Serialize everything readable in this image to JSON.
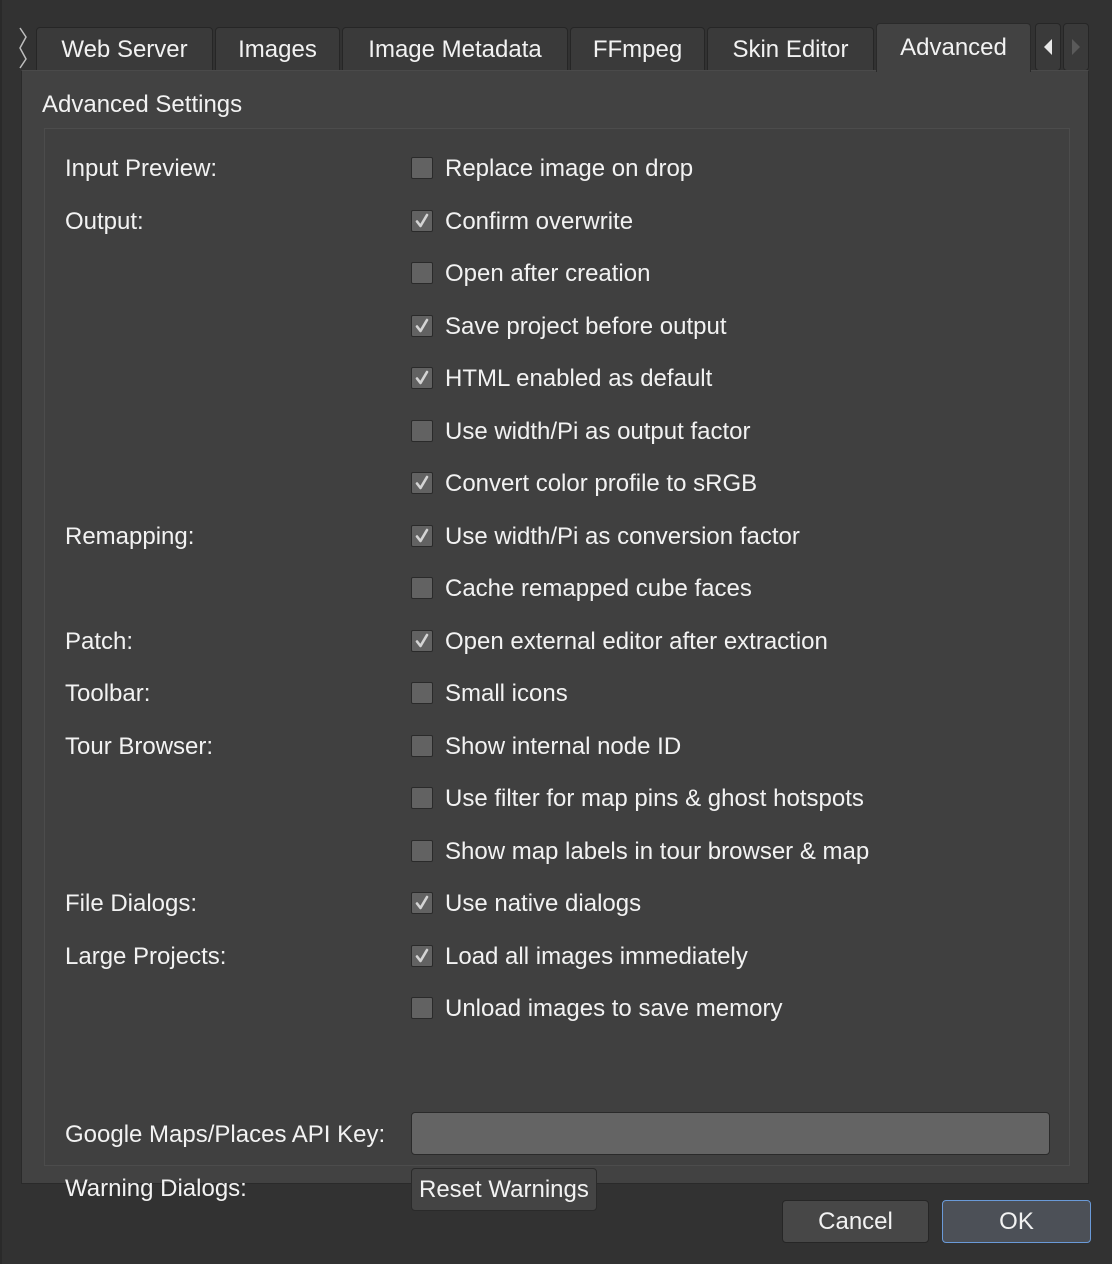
{
  "tabs": [
    {
      "label": "Web Server",
      "active": false
    },
    {
      "label": "Images",
      "active": false
    },
    {
      "label": "Image Metadata",
      "active": false
    },
    {
      "label": "FFmpeg",
      "active": false
    },
    {
      "label": "Skin Editor",
      "active": false
    },
    {
      "label": "Advanced",
      "active": true
    }
  ],
  "tab_scroll": {
    "left_icon": "triangle-left-icon",
    "right_icon": "triangle-right-icon",
    "right_enabled": false
  },
  "section_title": "Advanced Settings",
  "settings": [
    {
      "group": "Input Preview:",
      "label": "Replace image on drop",
      "checked": false
    },
    {
      "group": "Output:",
      "label": "Confirm overwrite",
      "checked": true
    },
    {
      "group": "",
      "label": "Open after creation",
      "checked": false
    },
    {
      "group": "",
      "label": "Save project before output",
      "checked": true
    },
    {
      "group": "",
      "label": "HTML enabled as default",
      "checked": true
    },
    {
      "group": "",
      "label": "Use width/Pi as output factor",
      "checked": false
    },
    {
      "group": "",
      "label": "Convert color profile to sRGB",
      "checked": true
    },
    {
      "group": "Remapping:",
      "label": "Use width/Pi as conversion factor",
      "checked": true
    },
    {
      "group": "",
      "label": "Cache remapped cube faces",
      "checked": false
    },
    {
      "group": "Patch:",
      "label": "Open external editor after extraction",
      "checked": true
    },
    {
      "group": "Toolbar:",
      "label": "Small icons",
      "checked": false
    },
    {
      "group": "Tour Browser:",
      "label": "Show internal node ID",
      "checked": false
    },
    {
      "group": "",
      "label": "Use filter for map pins & ghost hotspots",
      "checked": false
    },
    {
      "group": "",
      "label": "Show map labels in tour browser & map",
      "checked": false
    },
    {
      "group": "File Dialogs:",
      "label": "Use native dialogs",
      "checked": true
    },
    {
      "group": "Large Projects:",
      "label": "Load all images immediately",
      "checked": true
    },
    {
      "group": "",
      "label": "Unload images to save memory",
      "checked": false
    }
  ],
  "api_key": {
    "label": "Google Maps/Places API Key:",
    "value": "",
    "placeholder": ""
  },
  "warning_dialogs": {
    "label": "Warning Dialogs:",
    "button": "Reset Warnings"
  },
  "buttons": {
    "cancel": "Cancel",
    "ok": "OK"
  },
  "colors": {
    "accent": "#6a9ad8",
    "background": "#323232",
    "pane": "#424242",
    "checkbox": "#626262"
  }
}
